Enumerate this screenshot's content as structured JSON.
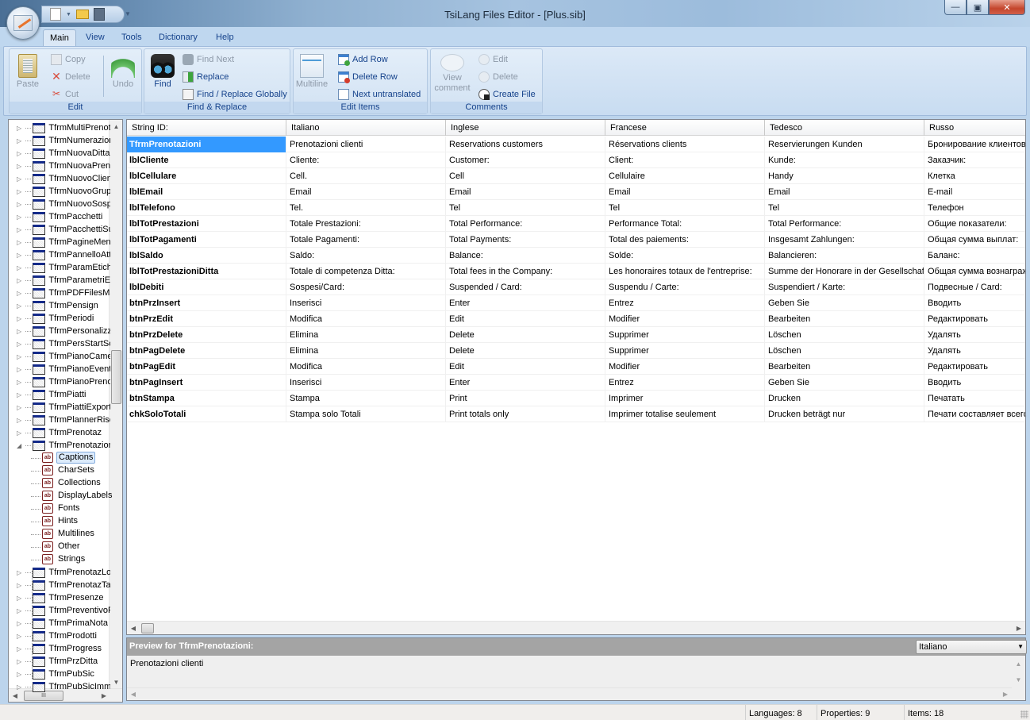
{
  "window": {
    "title": "TsiLang Files Editor - [Plus.sib]",
    "minimize": "—",
    "maximize": "□",
    "close": "X"
  },
  "ribbon": {
    "tabs": [
      "Main",
      "View",
      "Tools",
      "Dictionary",
      "Help"
    ],
    "active_tab": "Main",
    "groups": {
      "edit": {
        "caption": "Edit",
        "paste": "Paste",
        "copy": "Copy",
        "delete": "Delete",
        "cut": "Cut",
        "undo": "Undo"
      },
      "find_replace": {
        "caption": "Find & Replace",
        "find": "Find",
        "find_next": "Find Next",
        "replace": "Replace",
        "find_replace_globally": "Find / Replace Globally"
      },
      "edit_items": {
        "caption": "Edit Items",
        "multiline": "Multiline",
        "add_row": "Add Row",
        "delete_row": "Delete Row",
        "next_untranslated": "Next untranslated"
      },
      "comments": {
        "caption": "Comments",
        "view_comment_1": "View",
        "view_comment_2": "comment",
        "edit": "Edit",
        "delete": "Delete",
        "create_file": "Create File"
      }
    }
  },
  "tree": {
    "items_before": [
      "TfrmMultiPrenotaz",
      "TfrmNumerazione",
      "TfrmNuovaDitta",
      "TfrmNuovaPrenot",
      "TfrmNuovoCliente",
      "TfrmNuovoGruppo",
      "TfrmNuovoSospes",
      "TfrmPacchetti",
      "TfrmPacchettiSup",
      "TfrmPagineMenu",
      "TfrmPannelloAttiv",
      "TfrmParamEtichet",
      "TfrmParametriEtic",
      "TfrmPDFFilesMana",
      "TfrmPensign",
      "TfrmPeriodi",
      "TfrmPersonalizzaz",
      "TfrmPersStartScre",
      "TfrmPianoCamere",
      "TfrmPianoEventi",
      "TfrmPianoPrenota",
      "TfrmPiatti",
      "TfrmPiattiExportM",
      "TfrmPlannerRisors",
      "TfrmPrenotaz"
    ],
    "expanded_item": "TfrmPrenotazioni",
    "children": [
      "Captions",
      "CharSets",
      "Collections",
      "DisplayLabels",
      "Fonts",
      "Hints",
      "Multilines",
      "Other",
      "Strings"
    ],
    "selected_child": "Captions",
    "items_after": [
      "TfrmPrenotazLogs",
      "TfrmPrenotazTavo",
      "TfrmPresenze",
      "TfrmPreventivoPr",
      "TfrmPrimaNota",
      "TfrmProdotti",
      "TfrmProgress",
      "TfrmPrzDitta",
      "TfrmPubSic",
      "TfrmPubSicImmag"
    ]
  },
  "grid": {
    "columns": [
      "String ID:",
      "Italiano",
      "Inglese",
      "Francese",
      "Tedesco",
      "Russo"
    ],
    "selected_row": 0,
    "rows": [
      [
        "TfrmPrenotazioni",
        "Prenotazioni clienti",
        "Reservations customers",
        "Réservations clients",
        "Reservierungen Kunden",
        "Бронирование клиентов"
      ],
      [
        "lblCliente",
        "Cliente:",
        "Customer:",
        "Client:",
        "Kunde:",
        "Заказчик:"
      ],
      [
        "lblCellulare",
        "Cell.",
        "Cell",
        "Cellulaire",
        "Handy",
        "Клетка"
      ],
      [
        "lblEmail",
        "Email",
        "Email",
        "Email",
        "Email",
        "E-mail"
      ],
      [
        "lblTelefono",
        "Tel.",
        "Tel",
        "Tel",
        "Tel",
        "Телефон"
      ],
      [
        "lblTotPrestazioni",
        "Totale Prestazioni:",
        "Total Performance:",
        "Performance Total:",
        "Total Performance:",
        "Общие показатели:"
      ],
      [
        "lblTotPagamenti",
        "Totale Pagamenti:",
        "Total Payments:",
        "Total des paiements:",
        "Insgesamt Zahlungen:",
        "Общая сумма выплат:"
      ],
      [
        "lblSaldo",
        "Saldo:",
        "Balance:",
        "Solde:",
        "Balancieren:",
        "Баланс:"
      ],
      [
        "lblTotPrestazioniDitta",
        "Totale di competenza Ditta:",
        "Total fees in the Company:",
        "Les honoraires totaux de l'entreprise:",
        "Summe der Honorare in der Gesellschaft:",
        "Общая сумма вознаграж"
      ],
      [
        "lblDebiti",
        "Sospesi/Card:",
        "Suspended / Card:",
        "Suspendu / Carte:",
        "Suspendiert / Karte:",
        "Подвесные / Card:"
      ],
      [
        "btnPrzInsert",
        "Inserisci",
        "Enter",
        "Entrez",
        "Geben Sie",
        "Вводить"
      ],
      [
        "btnPrzEdit",
        "Modifica",
        "Edit",
        "Modifier",
        "Bearbeiten",
        "Редактировать"
      ],
      [
        "btnPrzDelete",
        "Elimina",
        "Delete",
        "Supprimer",
        "Löschen",
        "Удалять"
      ],
      [
        "btnPagDelete",
        "Elimina",
        "Delete",
        "Supprimer",
        "Löschen",
        "Удалять"
      ],
      [
        "btnPagEdit",
        "Modifica",
        "Edit",
        "Modifier",
        "Bearbeiten",
        "Редактировать"
      ],
      [
        "btnPagInsert",
        "Inserisci",
        "Enter",
        "Entrez",
        "Geben Sie",
        "Вводить"
      ],
      [
        "btnStampa",
        "Stampa",
        "Print",
        "Imprimer",
        "Drucken",
        "Печатать"
      ],
      [
        "chkSoloTotali",
        "Stampa solo Totali",
        "Print totals only",
        "Imprimer totalise seulement",
        "Drucken beträgt nur",
        "Печати составляет всего"
      ]
    ]
  },
  "preview": {
    "title": "Preview for TfrmPrenotazioni:",
    "language": "Italiano",
    "text": "Prenotazioni clienti"
  },
  "status": {
    "languages": "Languages: 8",
    "properties": "Properties: 9",
    "items": "Items: 18"
  },
  "colors": {
    "selection": "#3399ff",
    "ribbon_text": "#15428b",
    "preview_header": "#a4a4a4"
  }
}
